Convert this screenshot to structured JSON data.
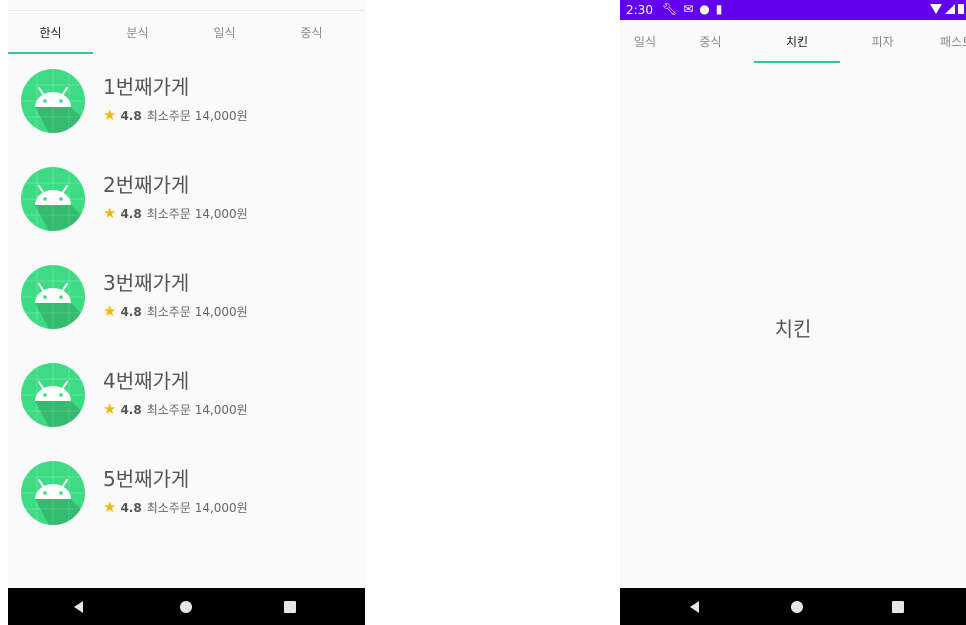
{
  "left": {
    "tabs": [
      {
        "label": "한식",
        "active": true
      },
      {
        "label": "분식",
        "active": false
      },
      {
        "label": "일식",
        "active": false
      },
      {
        "label": "중식",
        "active": false
      }
    ],
    "stores": [
      {
        "name": "1번째가게",
        "rating": "4.8",
        "min_order": "최소주문 14,000원"
      },
      {
        "name": "2번째가게",
        "rating": "4.8",
        "min_order": "최소주문 14,000원"
      },
      {
        "name": "3번째가게",
        "rating": "4.8",
        "min_order": "최소주문 14,000원"
      },
      {
        "name": "4번째가게",
        "rating": "4.8",
        "min_order": "최소주문 14,000원"
      },
      {
        "name": "5번째가게",
        "rating": "4.8",
        "min_order": "최소주문 14,000원"
      }
    ]
  },
  "right": {
    "status_bar": {
      "time": "2:30"
    },
    "tabs": [
      {
        "label": "일식",
        "active": false
      },
      {
        "label": "중식",
        "active": false
      },
      {
        "label": "치킨",
        "active": true
      },
      {
        "label": "피자",
        "active": false
      },
      {
        "label": "패스트",
        "active": false
      }
    ],
    "content_text": "치킨"
  },
  "colors": {
    "accent": "#2ec7a4",
    "status_bar": "#6200ee",
    "android_green": "#3ddc84",
    "star": "#f5b800"
  },
  "icons": {
    "avatar": "android-robot-icon",
    "star": "star-icon",
    "nav": [
      "back-triangle-icon",
      "home-circle-icon",
      "recents-square-icon"
    ]
  }
}
